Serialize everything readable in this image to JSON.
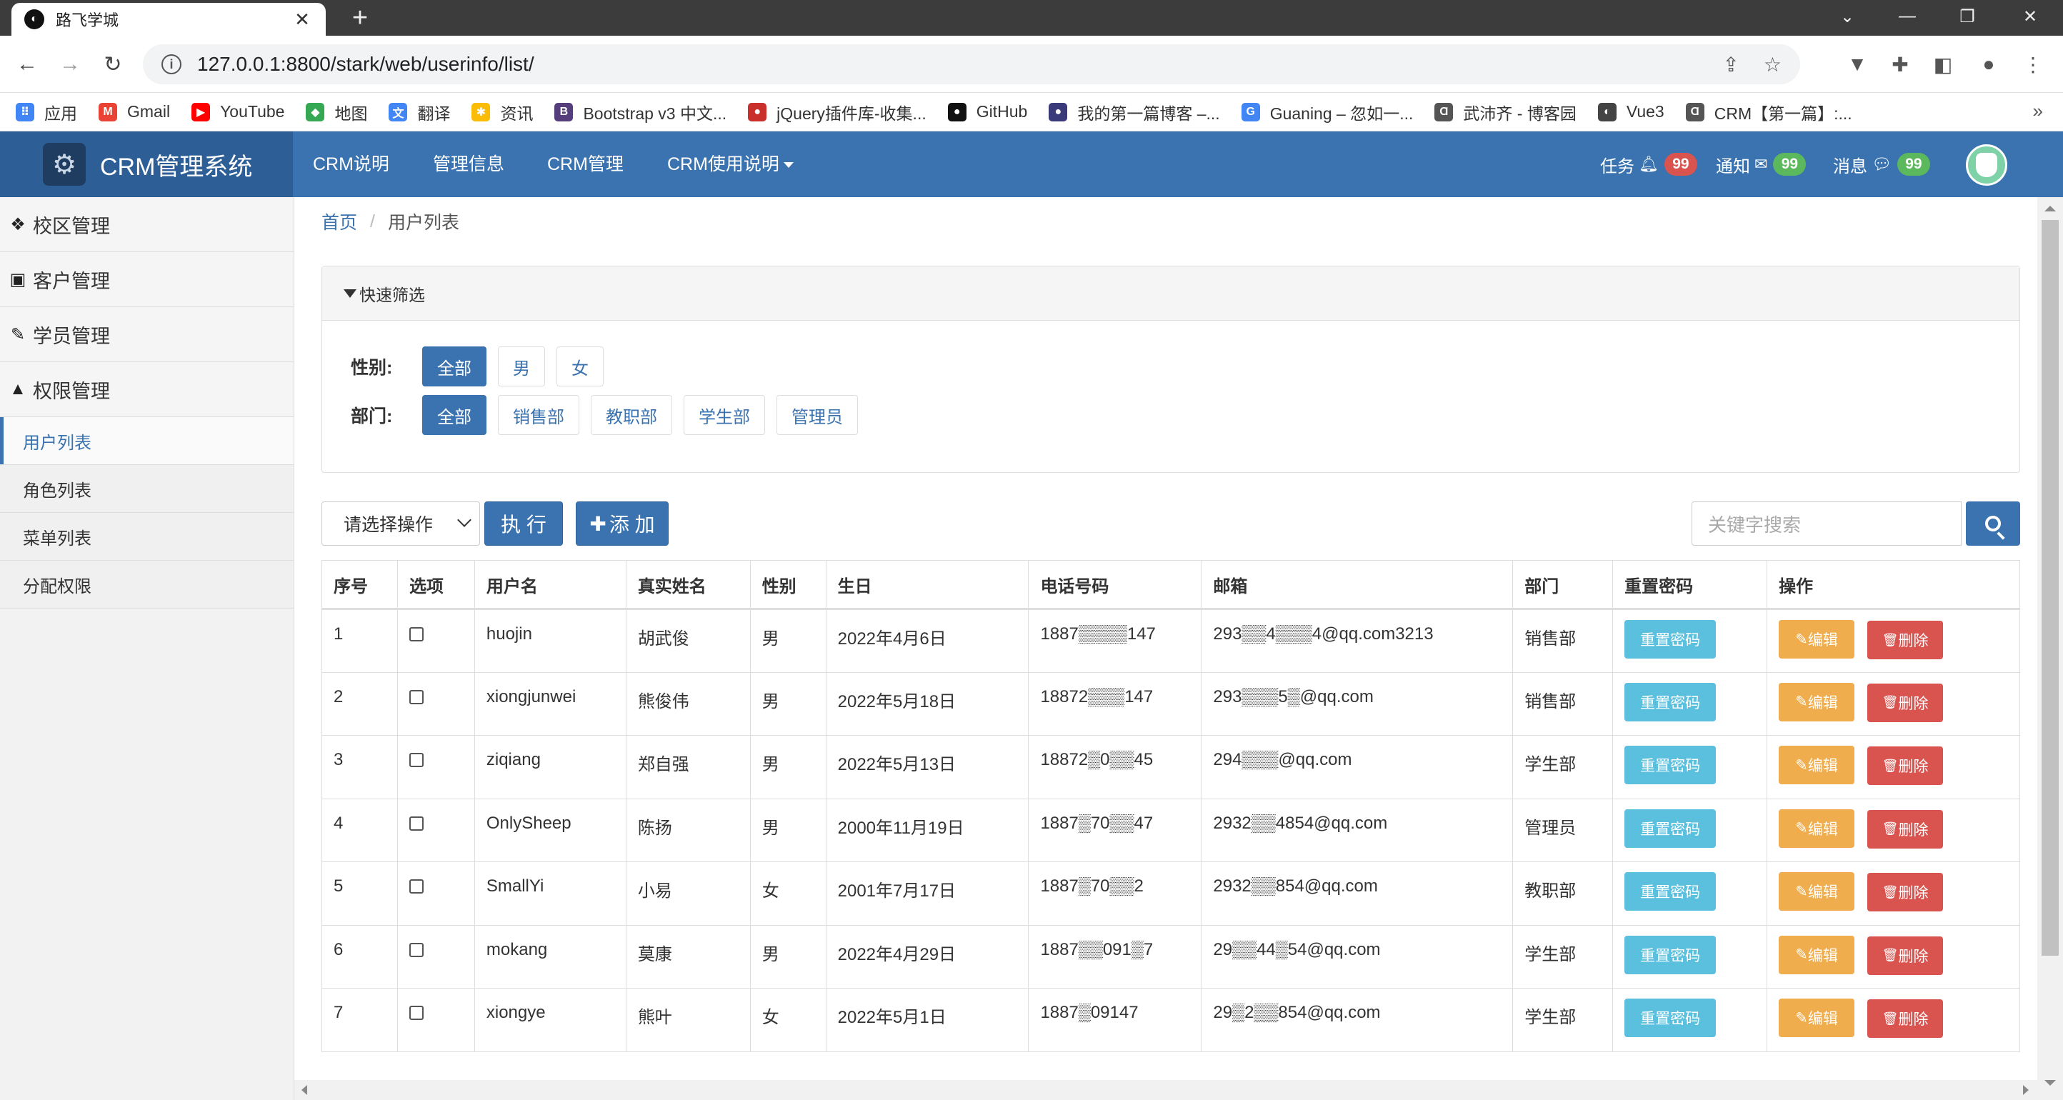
{
  "browser": {
    "tab_title": "路飞学城",
    "url": "127.0.0.1:8800/stark/web/userinfo/list/",
    "bookmarks": [
      {
        "label": "应用",
        "color": "#4285f4",
        "glyph": "⠿"
      },
      {
        "label": "Gmail",
        "color": "#ea4335",
        "glyph": "M"
      },
      {
        "label": "YouTube",
        "color": "#ff0000",
        "glyph": "▶"
      },
      {
        "label": "地图",
        "color": "#34a853",
        "glyph": "◆"
      },
      {
        "label": "翻译",
        "color": "#4285f4",
        "glyph": "文"
      },
      {
        "label": "资讯",
        "color": "#fbbc05",
        "glyph": "✱"
      },
      {
        "label": "Bootstrap v3 中文...",
        "color": "#563d7c",
        "glyph": "B"
      },
      {
        "label": "jQuery插件库-收集...",
        "color": "#c9302c",
        "glyph": "●"
      },
      {
        "label": "GitHub",
        "color": "#111111",
        "glyph": "●"
      },
      {
        "label": "我的第一篇博客 –...",
        "color": "#3a3a7a",
        "glyph": "●"
      },
      {
        "label": "Guaning – 忽如一...",
        "color": "#4285f4",
        "glyph": "G"
      },
      {
        "label": "武沛齐 - 博客园",
        "color": "#555555",
        "glyph": "Ɑ"
      },
      {
        "label": "Vue3",
        "color": "#444444",
        "glyph": "◐"
      },
      {
        "label": "CRM【第一篇】:...",
        "color": "#555555",
        "glyph": "Ɑ"
      }
    ]
  },
  "navbar": {
    "brand": "CRM管理系统",
    "menu": [
      "CRM说明",
      "管理信息",
      "CRM管理",
      "CRM使用说明"
    ],
    "tasks_label": "任务",
    "tasks_count": "99",
    "notify_label": "通知",
    "notify_count": "99",
    "msg_label": "消息",
    "msg_count": "99"
  },
  "sidebar": {
    "groups": [
      "校区管理",
      "客户管理",
      "学员管理",
      "权限管理"
    ],
    "items": [
      "用户列表",
      "角色列表",
      "菜单列表",
      "分配权限"
    ]
  },
  "breadcrumb": {
    "home": "首页",
    "current": "用户列表"
  },
  "filter": {
    "title": "快速筛选",
    "gender_label": "性别:",
    "gender_options": [
      "全部",
      "男",
      "女"
    ],
    "dept_label": "部门:",
    "dept_options": [
      "全部",
      "销售部",
      "教职部",
      "学生部",
      "管理员"
    ]
  },
  "toolbar": {
    "select_value": "请选择操作",
    "execute": "执 行",
    "add": "添 加",
    "search_placeholder": "关键字搜索"
  },
  "table": {
    "headers": [
      "序号",
      "选项",
      "用户名",
      "真实姓名",
      "性别",
      "生日",
      "电话号码",
      "邮箱",
      "部门",
      "重置密码",
      "操作"
    ],
    "reset_label": "重置密码",
    "edit_label": "编辑",
    "delete_label": "删除",
    "rows": [
      {
        "no": "1",
        "username": "huojin",
        "realname": "胡武俊",
        "gender": "男",
        "birthday": "2022年4月6日",
        "phone": "1887▒▒▒▒147",
        "email": "293▒▒4▒▒▒4@qq.com3213",
        "dept": "销售部"
      },
      {
        "no": "2",
        "username": "xiongjunwei",
        "realname": "熊俊伟",
        "gender": "男",
        "birthday": "2022年5月18日",
        "phone": "18872▒▒▒147",
        "email": "293▒▒▒5▒@qq.com",
        "dept": "销售部"
      },
      {
        "no": "3",
        "username": "ziqiang",
        "realname": "郑自强",
        "gender": "男",
        "birthday": "2022年5月13日",
        "phone": "18872▒0▒▒45",
        "email": "294▒▒▒@qq.com",
        "dept": "学生部"
      },
      {
        "no": "4",
        "username": "OnlySheep",
        "realname": "陈扬",
        "gender": "男",
        "birthday": "2000年11月19日",
        "phone": "1887▒70▒▒47",
        "email": "2932▒▒4854@qq.com",
        "dept": "管理员"
      },
      {
        "no": "5",
        "username": "SmallYi",
        "realname": "小易",
        "gender": "女",
        "birthday": "2001年7月17日",
        "phone": "1887▒70▒▒2",
        "email": "2932▒▒854@qq.com",
        "dept": "教职部"
      },
      {
        "no": "6",
        "username": "mokang",
        "realname": "莫康",
        "gender": "男",
        "birthday": "2022年4月29日",
        "phone": "1887▒▒091▒7",
        "email": "29▒▒44▒54@qq.com",
        "dept": "学生部"
      },
      {
        "no": "7",
        "username": "xiongye",
        "realname": "熊叶",
        "gender": "女",
        "birthday": "2022年5月1日",
        "phone": "1887▒09147",
        "email": "29▒2▒▒854@qq.com",
        "dept": "学生部"
      }
    ]
  },
  "colors": {
    "primary": "#3a73af",
    "info": "#5bc0de",
    "warning": "#f0ad4e",
    "danger": "#d9534f",
    "badge_red": "#d9534f",
    "badge_green": "#5cb85c"
  }
}
